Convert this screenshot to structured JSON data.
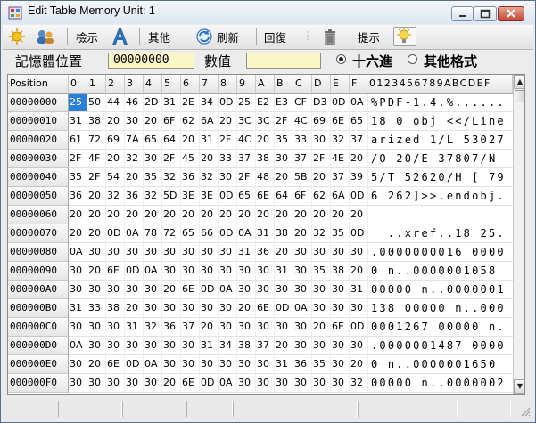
{
  "window": {
    "title": "Edit Table  Memory Unit: 1"
  },
  "toolbar": {
    "display_label": "檢示",
    "other_label": "其他",
    "refresh_label": "刷新",
    "restore_label": "回復",
    "hint_label": "提示"
  },
  "inputbar": {
    "address_label": "記憶體位置",
    "address_value": "00000000",
    "value_label": "數值",
    "value_value": "",
    "hex_label": "十六進",
    "other_format_label": "其他格式",
    "selected_format": "hex"
  },
  "grid": {
    "position_header": "Position",
    "hex_headers": [
      "0",
      "1",
      "2",
      "3",
      "4",
      "5",
      "6",
      "7",
      "8",
      "9",
      "A",
      "B",
      "C",
      "D",
      "E",
      "F"
    ],
    "ascii_header": "0123456789ABCDEF",
    "selected_cell": {
      "row": 0,
      "col": 0
    },
    "rows": [
      {
        "pos": "00000000",
        "hex": [
          "25",
          "50",
          "44",
          "46",
          "2D",
          "31",
          "2E",
          "34",
          "0D",
          "25",
          "E2",
          "E3",
          "CF",
          "D3",
          "0D",
          "0A"
        ],
        "ascii": "%PDF-1.4.%......"
      },
      {
        "pos": "00000010",
        "hex": [
          "31",
          "38",
          "20",
          "30",
          "20",
          "6F",
          "62",
          "6A",
          "20",
          "3C",
          "3C",
          "2F",
          "4C",
          "69",
          "6E",
          "65"
        ],
        "ascii": "18 0 obj <</Line"
      },
      {
        "pos": "00000020",
        "hex": [
          "61",
          "72",
          "69",
          "7A",
          "65",
          "64",
          "20",
          "31",
          "2F",
          "4C",
          "20",
          "35",
          "33",
          "30",
          "32",
          "37"
        ],
        "ascii": "arized 1/L 53027"
      },
      {
        "pos": "00000030",
        "hex": [
          "2F",
          "4F",
          "20",
          "32",
          "30",
          "2F",
          "45",
          "20",
          "33",
          "37",
          "38",
          "30",
          "37",
          "2F",
          "4E",
          "20"
        ],
        "ascii": "/O 20/E 37807/N "
      },
      {
        "pos": "00000040",
        "hex": [
          "35",
          "2F",
          "54",
          "20",
          "35",
          "32",
          "36",
          "32",
          "30",
          "2F",
          "48",
          "20",
          "5B",
          "20",
          "37",
          "39"
        ],
        "ascii": "5/T 52620/H [ 79"
      },
      {
        "pos": "00000050",
        "hex": [
          "36",
          "20",
          "32",
          "36",
          "32",
          "5D",
          "3E",
          "3E",
          "0D",
          "65",
          "6E",
          "64",
          "6F",
          "62",
          "6A",
          "0D"
        ],
        "ascii": "6 262]>>.endobj."
      },
      {
        "pos": "00000060",
        "hex": [
          "20",
          "20",
          "20",
          "20",
          "20",
          "20",
          "20",
          "20",
          "20",
          "20",
          "20",
          "20",
          "20",
          "20",
          "20",
          "20"
        ],
        "ascii": "                "
      },
      {
        "pos": "00000070",
        "hex": [
          "20",
          "20",
          "0D",
          "0A",
          "78",
          "72",
          "65",
          "66",
          "0D",
          "0A",
          "31",
          "38",
          "20",
          "32",
          "35",
          "0D"
        ],
        "ascii": "  ..xref..18 25."
      },
      {
        "pos": "00000080",
        "hex": [
          "0A",
          "30",
          "30",
          "30",
          "30",
          "30",
          "30",
          "30",
          "30",
          "31",
          "36",
          "20",
          "30",
          "30",
          "30",
          "30"
        ],
        "ascii": ".0000000016 0000"
      },
      {
        "pos": "00000090",
        "hex": [
          "30",
          "20",
          "6E",
          "0D",
          "0A",
          "30",
          "30",
          "30",
          "30",
          "30",
          "30",
          "31",
          "30",
          "35",
          "38",
          "20"
        ],
        "ascii": "0 n..0000001058 "
      },
      {
        "pos": "000000A0",
        "hex": [
          "30",
          "30",
          "30",
          "30",
          "30",
          "20",
          "6E",
          "0D",
          "0A",
          "30",
          "30",
          "30",
          "30",
          "30",
          "30",
          "31"
        ],
        "ascii": "00000 n..0000001"
      },
      {
        "pos": "000000B0",
        "hex": [
          "31",
          "33",
          "38",
          "20",
          "30",
          "30",
          "30",
          "30",
          "30",
          "20",
          "6E",
          "0D",
          "0A",
          "30",
          "30",
          "30"
        ],
        "ascii": "138 00000 n..000"
      },
      {
        "pos": "000000C0",
        "hex": [
          "30",
          "30",
          "30",
          "31",
          "32",
          "36",
          "37",
          "20",
          "30",
          "30",
          "30",
          "30",
          "30",
          "20",
          "6E",
          "0D"
        ],
        "ascii": "0001267 00000 n."
      },
      {
        "pos": "000000D0",
        "hex": [
          "0A",
          "30",
          "30",
          "30",
          "30",
          "30",
          "30",
          "31",
          "34",
          "38",
          "37",
          "20",
          "30",
          "30",
          "30",
          "30"
        ],
        "ascii": ".0000001487 0000"
      },
      {
        "pos": "000000E0",
        "hex": [
          "30",
          "20",
          "6E",
          "0D",
          "0A",
          "30",
          "30",
          "30",
          "30",
          "30",
          "30",
          "31",
          "36",
          "35",
          "30",
          "20"
        ],
        "ascii": "0 n..0000001650 "
      },
      {
        "pos": "000000F0",
        "hex": [
          "30",
          "30",
          "30",
          "30",
          "30",
          "20",
          "6E",
          "0D",
          "0A",
          "30",
          "30",
          "30",
          "30",
          "30",
          "30",
          "32"
        ],
        "ascii": "00000 n..0000002"
      }
    ]
  },
  "colors": {
    "selection": "#2a7fd6",
    "input_bg": "#fbf6c6"
  }
}
